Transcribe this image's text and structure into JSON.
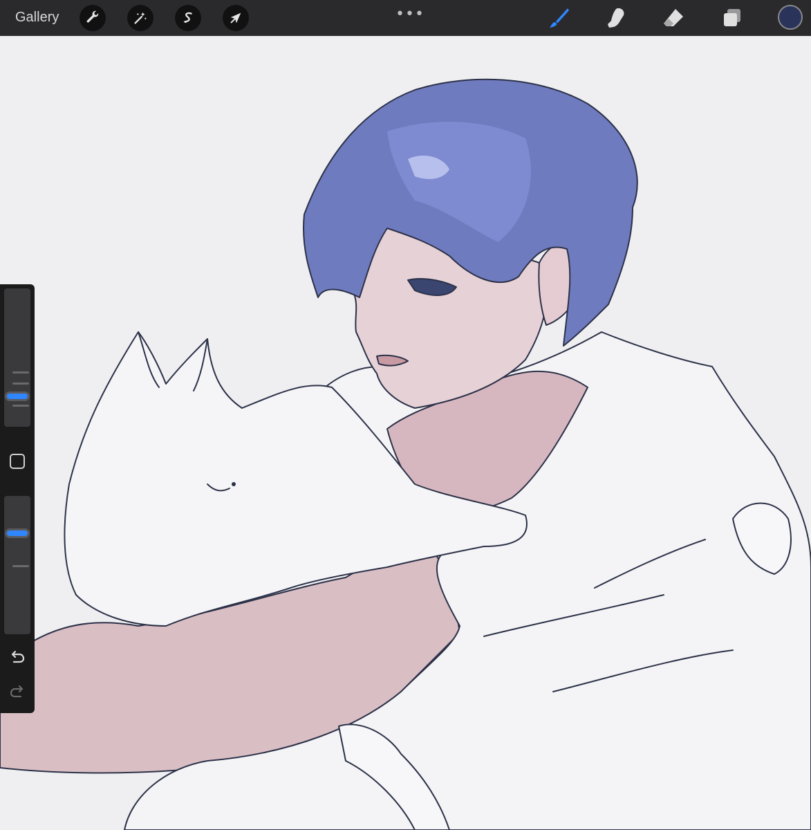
{
  "toolbar": {
    "gallery_label": "Gallery",
    "more_label": "•••",
    "left_tools": [
      {
        "name": "actions",
        "icon": "wrench-icon"
      },
      {
        "name": "adjustments",
        "icon": "magic-wand-icon"
      },
      {
        "name": "selection",
        "icon": "selection-s-icon"
      },
      {
        "name": "transform",
        "icon": "arrow-cursor-icon"
      }
    ],
    "right_tools": [
      {
        "name": "brush",
        "icon": "brush-icon",
        "active": true
      },
      {
        "name": "smudge",
        "icon": "smudge-finger-icon",
        "active": false
      },
      {
        "name": "eraser",
        "icon": "eraser-icon",
        "active": false
      },
      {
        "name": "layers",
        "icon": "layers-icon",
        "active": false
      }
    ],
    "current_color": "#2a3359",
    "accent_color": "#2f86ff"
  },
  "sidebar": {
    "brush_size_level": 0.25,
    "opacity_level": 0.75,
    "modify_icon": "square-modifier-icon",
    "undo_icon": "undo-icon",
    "redo_icon": "redo-icon"
  },
  "canvas": {
    "background": "#efeff1",
    "content": "artwork"
  }
}
